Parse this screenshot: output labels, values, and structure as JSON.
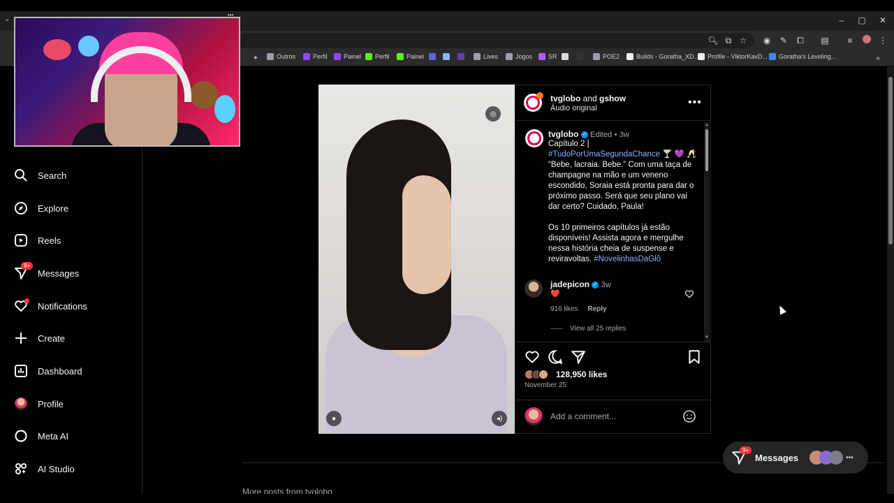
{
  "bookmarks": [
    {
      "label": "Outros",
      "color": "#9aa0a6"
    },
    {
      "label": "Perfil",
      "color": "#9146ff"
    },
    {
      "label": "Painel",
      "color": "#9146ff"
    },
    {
      "label": "Perfil",
      "color": "#53fc18"
    },
    {
      "label": "Painel",
      "color": "#53fc18"
    },
    {
      "label": "",
      "color": "#5865f2"
    },
    {
      "label": "",
      "color": "#8ab4f8"
    },
    {
      "label": "",
      "color": "#6441a5"
    },
    {
      "label": "Lives",
      "color": "#9aa0a6"
    },
    {
      "label": "Jogos",
      "color": "#9aa0a6"
    },
    {
      "label": "SR",
      "color": "#b05cff"
    },
    {
      "label": "",
      "color": "#ddd"
    },
    {
      "label": "",
      "color": "#333"
    },
    {
      "label": "POE2",
      "color": "#9aa0a6"
    },
    {
      "label": "Builds - Goratha_XD...",
      "color": "#eee"
    },
    {
      "label": "Profile - ViktorKavD...",
      "color": "#eee"
    },
    {
      "label": "Goratha's Leveling...",
      "color": "#4285f4"
    }
  ],
  "sidebar": {
    "items": [
      {
        "label": "Search",
        "icon": "search-icon"
      },
      {
        "label": "Explore",
        "icon": "compass-icon"
      },
      {
        "label": "Reels",
        "icon": "reels-icon"
      },
      {
        "label": "Messages",
        "icon": "messenger-icon",
        "badge": "9+"
      },
      {
        "label": "Notifications",
        "icon": "heart-icon"
      },
      {
        "label": "Create",
        "icon": "plus-icon"
      },
      {
        "label": "Dashboard",
        "icon": "dashboard-icon"
      },
      {
        "label": "Profile",
        "icon": "avatar"
      },
      {
        "label": "Meta AI",
        "icon": "meta-ai-icon"
      },
      {
        "label": "AI Studio",
        "icon": "ai-studio-icon"
      }
    ]
  },
  "post": {
    "header_author": "tvglobo",
    "header_and": "and",
    "header_coauthor": "gshow",
    "header_audio": "Áudio original",
    "caption_author": "tvglobo",
    "caption_edited": "Edited",
    "caption_time": "3w",
    "caption_line1": "Capítulo 2 |",
    "caption_tag1": "#TudoPorUmaSegundaChance",
    "caption_emoji": "🍸 💜 🥂",
    "caption_body": "“Bebe, lacraia. Bebe.” Com uma taça de champagne na mão e um veneno escondido, Soraia está pronta para dar o próximo passo. Será que seu plano vai dar certo? Cuidado, Paula!",
    "caption_body2": "Os 10 primeiros capítulos já estão disponíveis! Assista agora e mergulhe nessa história cheia de suspense e reviravoltas.",
    "caption_tag2": "#NovelinhasDaGlô",
    "comment_user": "jadepicon",
    "comment_time": "3w",
    "comment_text": "❤️",
    "comment_likes": "916 likes",
    "comment_reply": "Reply",
    "view_replies": "View all 25 replies",
    "likes": "128,950 likes",
    "date": "November 25",
    "add_comment_placeholder": "Add a comment..."
  },
  "more_posts": "More posts from tvglobo",
  "messages_pill": {
    "label": "Messages",
    "badge": "9+"
  },
  "colors": {
    "accent": "#0095f6",
    "badge": "#ff3040",
    "tag": "#8ab4ff"
  }
}
